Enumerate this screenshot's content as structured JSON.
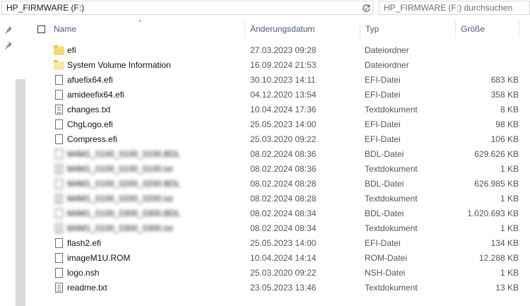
{
  "address": {
    "path": "HP_FIRMWARE (F:)"
  },
  "search": {
    "placeholder": "HP_FIRMWARE (F:) durchsuchen"
  },
  "columns": {
    "name": "Name",
    "date": "Änderungsdatum",
    "type": "Typ",
    "size": "Größe"
  },
  "files": [
    {
      "name": "efi",
      "date": "27.03.2023 09:28",
      "type": "Dateiordner",
      "size": "",
      "icon": "folder-icon"
    },
    {
      "name": "System Volume Information",
      "date": "16.09.2024 21:53",
      "type": "Dateiordner",
      "size": "",
      "icon": "folder-icon"
    },
    {
      "name": "afuefix64.efi",
      "date": "30.10.2023 14:11",
      "type": "EFI-Datei",
      "size": "683 KB",
      "icon": "file-icon"
    },
    {
      "name": "amideefix64.efi",
      "date": "04.12.2020 13:54",
      "type": "EFI-Datei",
      "size": "358 KB",
      "icon": "file-icon"
    },
    {
      "name": "changes.txt",
      "date": "10.04.2024 17:36",
      "type": "Textdokument",
      "size": "8 KB",
      "icon": "text-file-icon"
    },
    {
      "name": "ChgLogo.efi",
      "date": "25.05.2023 14:00",
      "type": "EFI-Datei",
      "size": "98 KB",
      "icon": "file-icon"
    },
    {
      "name": "Compress.efi",
      "date": "25.03.2020 09:22",
      "type": "EFI-Datei",
      "size": "106 KB",
      "icon": "file-icon"
    },
    {
      "name": "M4M1_0100_0100_0100.BDL",
      "date": "08.02.2024 08:36",
      "type": "BDL-Datei",
      "size": "629.626 KB",
      "icon": "file-icon",
      "blurred": true
    },
    {
      "name": "M4M1_0100_0100_0100.txt",
      "date": "08.02.2024 08:36",
      "type": "Textdokument",
      "size": "1 KB",
      "icon": "text-file-icon",
      "blurred": true
    },
    {
      "name": "M4M1_0100_0200_0200.BDL",
      "date": "08.02.2024 08:28",
      "type": "BDL-Datei",
      "size": "626.985 KB",
      "icon": "file-icon",
      "blurred": true
    },
    {
      "name": "M4M1_0100_0200_0200.txt",
      "date": "08.02.2024 08:28",
      "type": "Textdokument",
      "size": "1 KB",
      "icon": "text-file-icon",
      "blurred": true
    },
    {
      "name": "M4M1_0100_0300_0300.BDL",
      "date": "08.02.2024 08:34",
      "type": "BDL-Datei",
      "size": "1.020.693 KB",
      "icon": "file-icon",
      "blurred": true
    },
    {
      "name": "M4M1_0100_0300_0300.txt",
      "date": "08.02.2024 08:34",
      "type": "Textdokument",
      "size": "1 KB",
      "icon": "text-file-icon",
      "blurred": true
    },
    {
      "name": "flash2.efi",
      "date": "25.05.2023 14:00",
      "type": "EFI-Datei",
      "size": "134 KB",
      "icon": "file-icon"
    },
    {
      "name": "imageM1U.ROM",
      "date": "10.04.2024 14:14",
      "type": "ROM-Datei",
      "size": "12.288 KB",
      "icon": "file-icon"
    },
    {
      "name": "logo.nsh",
      "date": "25.03.2020 09:22",
      "type": "NSH-Datei",
      "size": "1 KB",
      "icon": "file-icon"
    },
    {
      "name": "readme.txt",
      "date": "23.05.2023 13:46",
      "type": "Textdokument",
      "size": "13 KB",
      "icon": "text-file-icon"
    }
  ]
}
